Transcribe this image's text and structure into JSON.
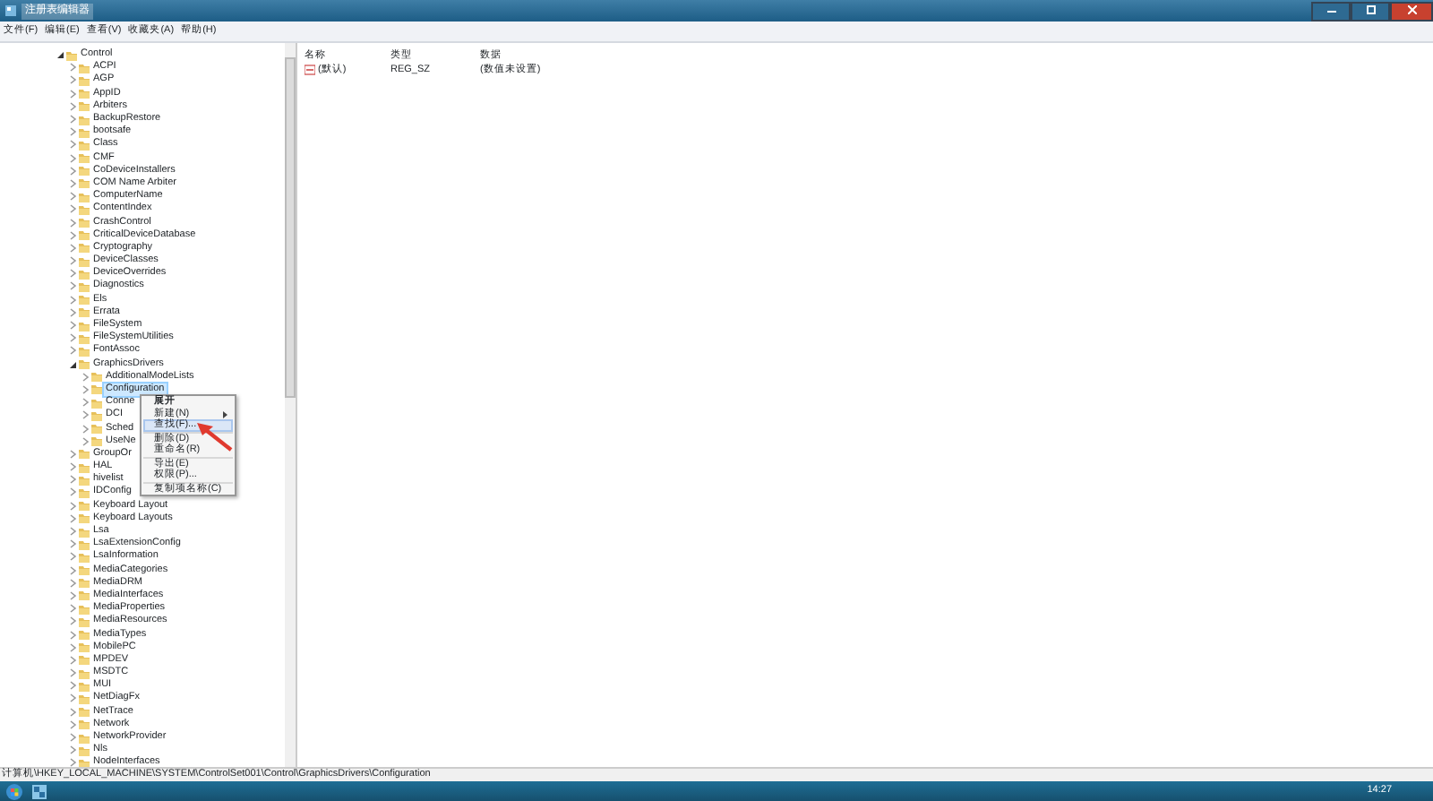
{
  "window": {
    "title": "注册表编辑器"
  },
  "menu_bar": [
    "文件(F)",
    "编辑(E)",
    "查看(V)",
    "收藏夹(A)",
    "帮助(H)"
  ],
  "tree": [
    {
      "label": "Control",
      "expanded": true,
      "selected": false,
      "children": [
        {
          "label": "ACPI",
          "expanded": false,
          "selected": false
        },
        {
          "label": "AGP",
          "expanded": false,
          "selected": false
        },
        {
          "label": "AppID",
          "expanded": false,
          "selected": false
        },
        {
          "label": "Arbiters",
          "expanded": false,
          "selected": false
        },
        {
          "label": "BackupRestore",
          "expanded": false,
          "selected": false
        },
        {
          "label": "bootsafe",
          "expanded": false,
          "selected": false
        },
        {
          "label": "Class",
          "expanded": false,
          "selected": false
        },
        {
          "label": "CMF",
          "expanded": false,
          "selected": false
        },
        {
          "label": "CoDeviceInstallers",
          "expanded": false,
          "selected": false
        },
        {
          "label": "COM Name Arbiter",
          "expanded": false,
          "selected": false
        },
        {
          "label": "ComputerName",
          "expanded": false,
          "selected": false
        },
        {
          "label": "ContentIndex",
          "expanded": false,
          "selected": false
        },
        {
          "label": "CrashControl",
          "expanded": false,
          "selected": false
        },
        {
          "label": "CriticalDeviceDatabase",
          "expanded": false,
          "selected": false
        },
        {
          "label": "Cryptography",
          "expanded": false,
          "selected": false
        },
        {
          "label": "DeviceClasses",
          "expanded": false,
          "selected": false
        },
        {
          "label": "DeviceOverrides",
          "expanded": false,
          "selected": false
        },
        {
          "label": "Diagnostics",
          "expanded": false,
          "selected": false
        },
        {
          "label": "Els",
          "expanded": false,
          "selected": false
        },
        {
          "label": "Errata",
          "expanded": false,
          "selected": false
        },
        {
          "label": "FileSystem",
          "expanded": false,
          "selected": false
        },
        {
          "label": "FileSystemUtilities",
          "expanded": false,
          "selected": false
        },
        {
          "label": "FontAssoc",
          "expanded": false,
          "selected": false
        },
        {
          "label": "GraphicsDrivers",
          "expanded": true,
          "selected": false,
          "children": [
            {
              "label": "AdditionalModeLists",
              "expanded": false,
              "selected": false
            },
            {
              "label": "Configuration",
              "expanded": false,
              "selected": true
            },
            {
              "label": "Conne",
              "expanded": false,
              "selected": false
            },
            {
              "label": "DCI",
              "expanded": false,
              "selected": false
            },
            {
              "label": "Sched",
              "expanded": false,
              "selected": false
            },
            {
              "label": "UseNe",
              "expanded": false,
              "selected": false
            }
          ]
        },
        {
          "label": "GroupOr",
          "expanded": false,
          "selected": false
        },
        {
          "label": "HAL",
          "expanded": false,
          "selected": false
        },
        {
          "label": "hivelist",
          "expanded": false,
          "selected": false
        },
        {
          "label": "IDConfig",
          "expanded": false,
          "selected": false
        },
        {
          "label": "Keyboard Layout",
          "expanded": false,
          "selected": false
        },
        {
          "label": "Keyboard Layouts",
          "expanded": false,
          "selected": false
        },
        {
          "label": "Lsa",
          "expanded": false,
          "selected": false
        },
        {
          "label": "LsaExtensionConfig",
          "expanded": false,
          "selected": false
        },
        {
          "label": "LsaInformation",
          "expanded": false,
          "selected": false
        },
        {
          "label": "MediaCategories",
          "expanded": false,
          "selected": false
        },
        {
          "label": "MediaDRM",
          "expanded": false,
          "selected": false
        },
        {
          "label": "MediaInterfaces",
          "expanded": false,
          "selected": false
        },
        {
          "label": "MediaProperties",
          "expanded": false,
          "selected": false
        },
        {
          "label": "MediaResources",
          "expanded": false,
          "selected": false
        },
        {
          "label": "MediaTypes",
          "expanded": false,
          "selected": false
        },
        {
          "label": "MobilePC",
          "expanded": false,
          "selected": false
        },
        {
          "label": "MPDEV",
          "expanded": false,
          "selected": false
        },
        {
          "label": "MSDTC",
          "expanded": false,
          "selected": false
        },
        {
          "label": "MUI",
          "expanded": false,
          "selected": false
        },
        {
          "label": "NetDiagFx",
          "expanded": false,
          "selected": false
        },
        {
          "label": "NetTrace",
          "expanded": false,
          "selected": false
        },
        {
          "label": "Network",
          "expanded": false,
          "selected": false
        },
        {
          "label": "NetworkProvider",
          "expanded": false,
          "selected": false
        },
        {
          "label": "Nls",
          "expanded": false,
          "selected": false
        },
        {
          "label": "NodeInterfaces",
          "expanded": false,
          "selected": false
        }
      ]
    }
  ],
  "values_table": {
    "columns": [
      "名称",
      "类型",
      "数据"
    ],
    "rows": [
      [
        "(默认)",
        "REG_SZ",
        "(数值未设置)"
      ]
    ]
  },
  "context_menu": [
    {
      "label": "展开",
      "default": true,
      "selected": false,
      "submenu": false,
      "separator_after": false
    },
    {
      "label": "新建(N)",
      "default": false,
      "selected": false,
      "submenu": true,
      "separator_after": false
    },
    {
      "label": "查找(F)...",
      "default": false,
      "selected": true,
      "submenu": false,
      "separator_after": true
    },
    {
      "label": "删除(D)",
      "default": false,
      "selected": false,
      "submenu": false,
      "separator_after": false
    },
    {
      "label": "重命名(R)",
      "default": false,
      "selected": false,
      "submenu": false,
      "separator_after": true
    },
    {
      "label": "导出(E)",
      "default": false,
      "selected": false,
      "submenu": false,
      "separator_after": false
    },
    {
      "label": "权限(P)...",
      "default": false,
      "selected": false,
      "submenu": false,
      "separator_after": true
    },
    {
      "label": "复制项名称(C)",
      "default": false,
      "selected": false,
      "submenu": false,
      "separator_after": false
    }
  ],
  "status_bar": "计算机\\HKEY_LOCAL_MACHINE\\SYSTEM\\ControlSet001\\Control\\GraphicsDrivers\\Configuration",
  "taskbar": {
    "clock": "14:27"
  }
}
